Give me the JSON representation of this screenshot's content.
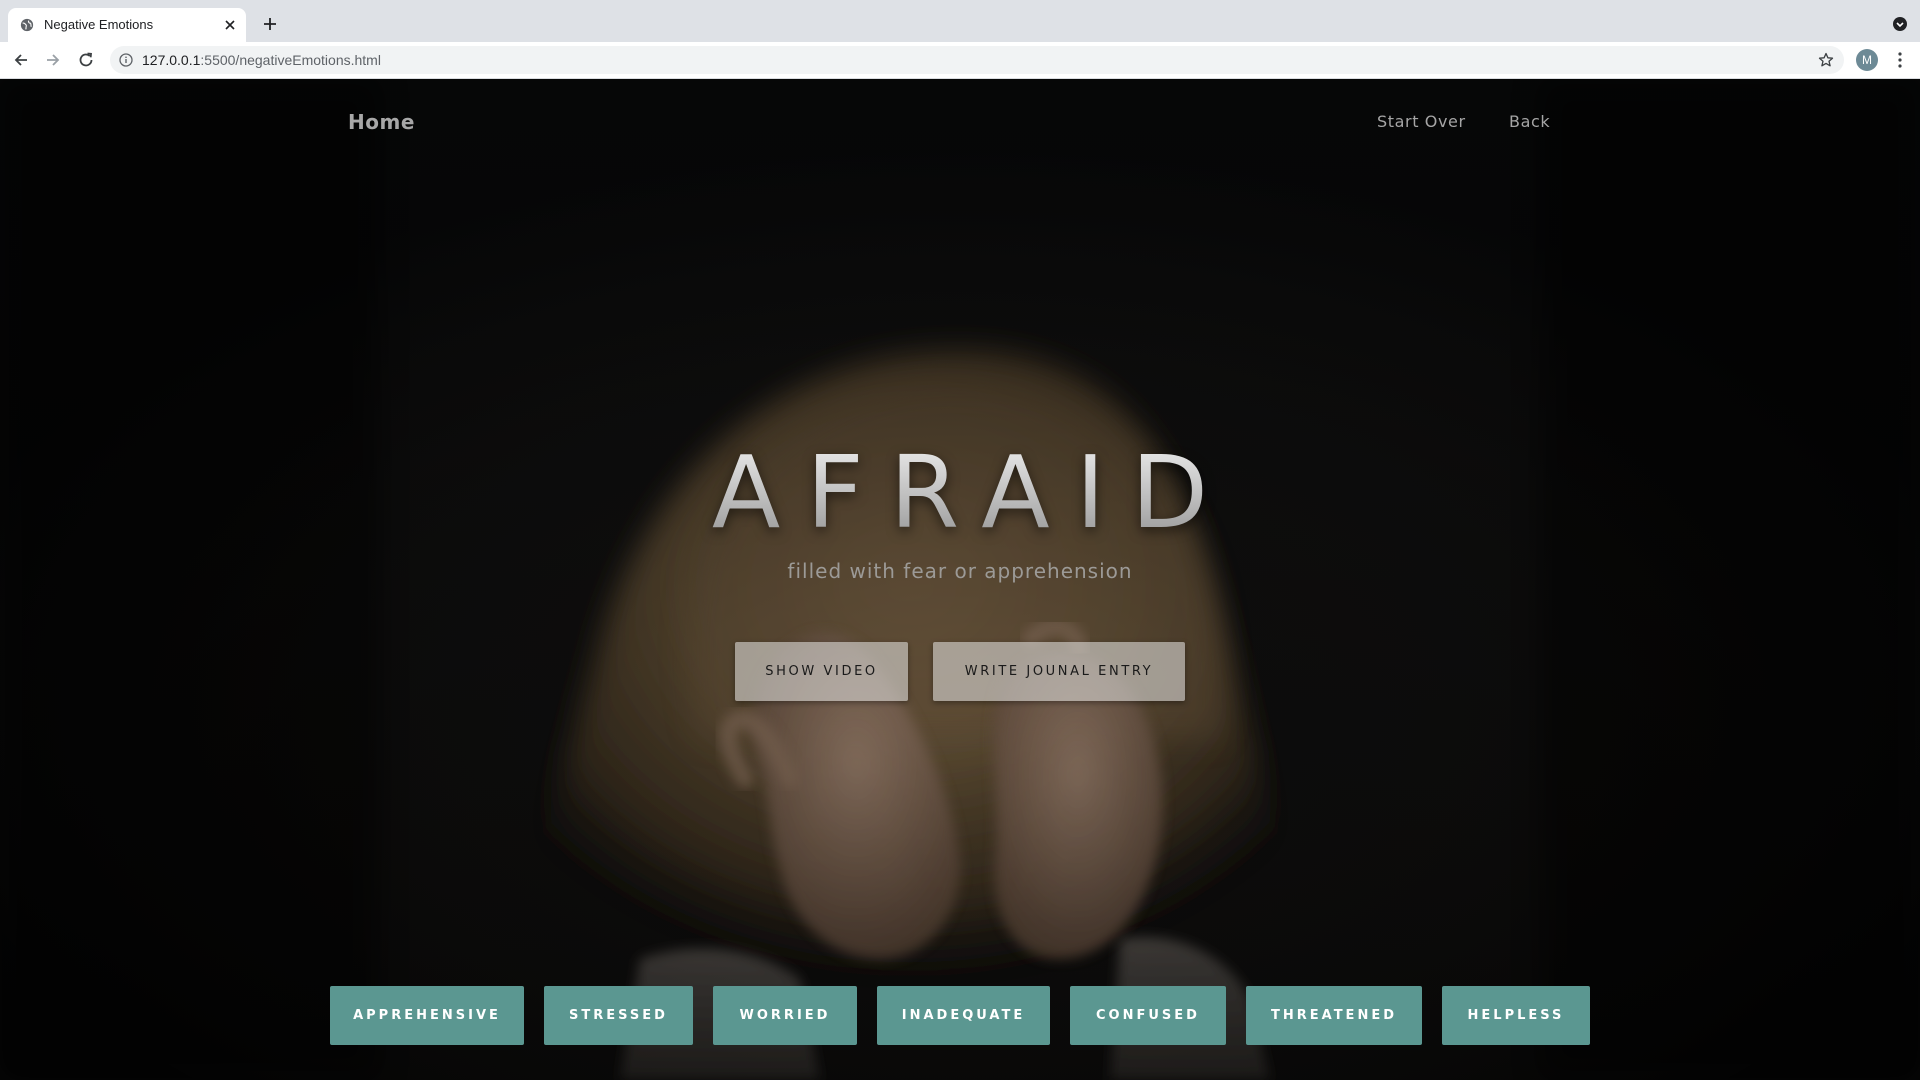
{
  "browser": {
    "tab": {
      "title": "Negative Emotions",
      "favicon": "globe-icon"
    },
    "url": {
      "host": "127.0.0.1",
      "path": ":5500/negativeEmotions.html"
    },
    "avatar_letter": "M"
  },
  "nav": {
    "home": "Home",
    "start_over": "Start Over",
    "back": "Back"
  },
  "hero": {
    "title": "AFRAID",
    "subtitle": "filled with fear or apprehension",
    "show_video": "SHOW VIDEO",
    "journal": "WRITE JOUNAL ENTRY"
  },
  "emotions": {
    "items": [
      {
        "label": "APPREHENSIVE"
      },
      {
        "label": "STRESSED"
      },
      {
        "label": "WORRIED"
      },
      {
        "label": "INADEQUATE"
      },
      {
        "label": "CONFUSED"
      },
      {
        "label": "THREATENED"
      },
      {
        "label": "HELPLESS"
      }
    ]
  },
  "colors": {
    "emotion_button": "#5b9791",
    "page_background": "#0b0b0b",
    "hero_button": "#d7d5d2"
  }
}
